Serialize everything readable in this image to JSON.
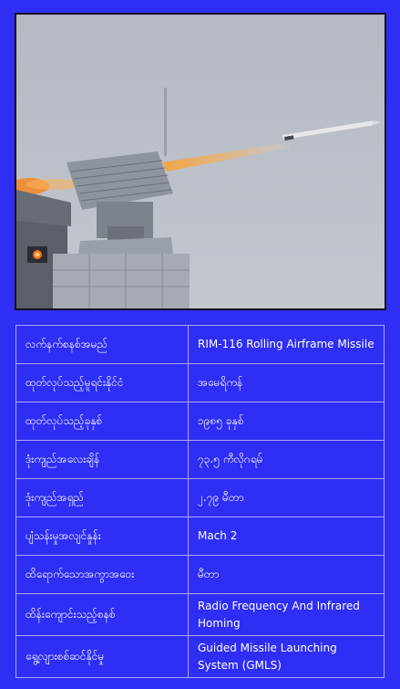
{
  "colors": {
    "background": "#2e2ef5",
    "border": "#a9a9ff",
    "text": "#ffffff"
  },
  "specs": [
    {
      "label": "လက်နက်စနစ်အမည်",
      "value": "RIM-116 Rolling Airframe Missile"
    },
    {
      "label": "ထုတ်လုပ်သည့်မူရင်းနိုင်ငံ",
      "value": "အမေရိကန်"
    },
    {
      "label": "ထုတ်လုပ်သည့်ခုနှစ်",
      "value": "၁၉၈၅ ခုနှစ်"
    },
    {
      "label": "ဒုံးကျည်အလေးချိန်",
      "value": "၇၃.၅ ကီလိုဂရမ်"
    },
    {
      "label": "ဒုံးကျည်အရှည်",
      "value": "၂.၇၉ မီတာ"
    },
    {
      "label": "ပျံသန်းမှုအလျင်နှုန်း",
      "value": "Mach 2"
    },
    {
      "label": "ထိရောက်သောအကွာအဝေး",
      "value": "မီတာ"
    },
    {
      "label": "ထိန်းကျောင်းသည့်စနစ်",
      "value": "Radio Frequency And Infrared Homing"
    },
    {
      "label": "ရွေ့လျားစစ်ဆင်နိုင်မှု",
      "value": "Guided Missile Launching System (GMLS)"
    }
  ]
}
